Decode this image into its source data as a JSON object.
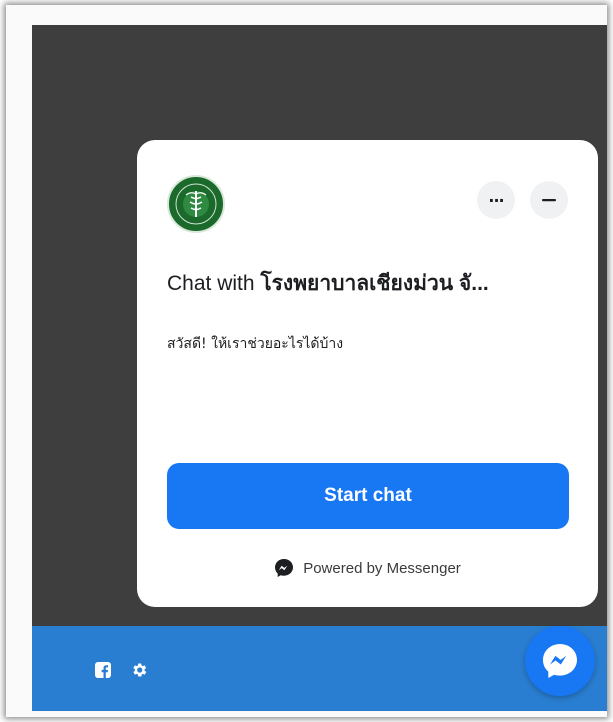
{
  "card": {
    "title_prefix": "Chat with ",
    "title_name": "โรงพยาบาลเชียงม่วน จั...",
    "greeting": "สวัสดี! ให้เราช่วยอะไรได้บ้าง",
    "start_chat_label": "Start chat",
    "powered_by_label": "Powered by Messenger",
    "more_options_label": "···"
  },
  "footer": {
    "icons": [
      "facebook-icon",
      "gear-icon"
    ]
  },
  "colors": {
    "primary": "#1877f2",
    "footer_bar": "#2a7ed1",
    "dark_bg": "#3e3e3e",
    "logo_green": "#1b6a2c"
  }
}
